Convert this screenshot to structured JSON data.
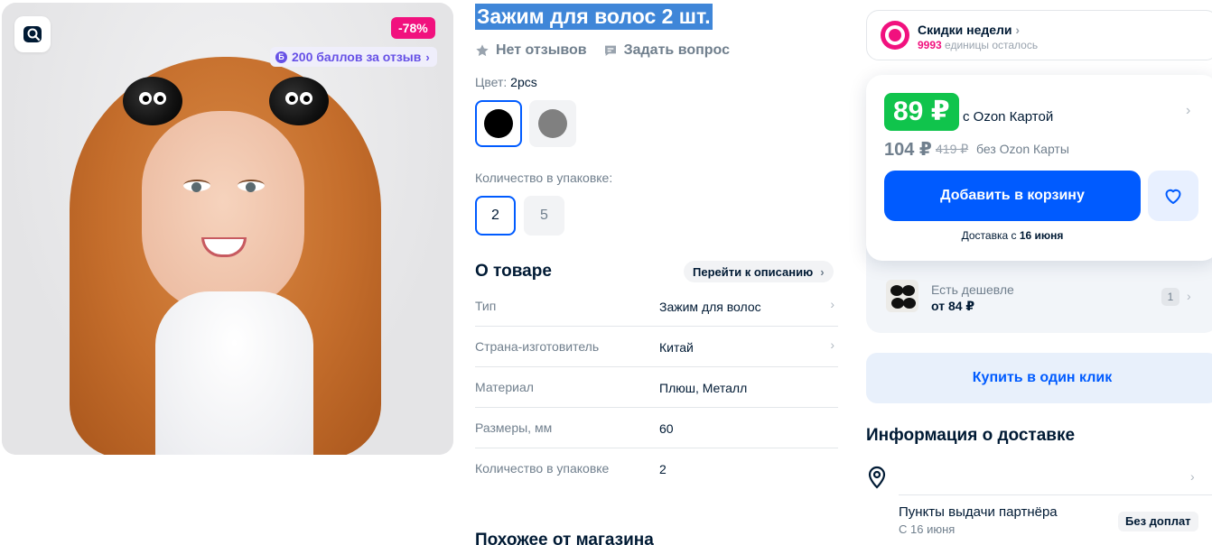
{
  "product": {
    "title": "Зажим для волос 2 шт.",
    "reviews_label": "Нет отзывов",
    "ask_label": "Задать вопрос"
  },
  "gallery": {
    "discount": "-78%",
    "points_label": "200 баллов за отзыв",
    "points_coin": "Б"
  },
  "variants": {
    "color_label": "Цвет:",
    "color_value": "2pcs",
    "swatches": [
      {
        "color": "#000000",
        "selected": true
      },
      {
        "color": "#808080",
        "selected": false
      }
    ],
    "qty_label": "Количество в упаковке:",
    "qty_options": [
      "2",
      "5"
    ],
    "qty_selected": "2"
  },
  "about": {
    "title": "О товаре",
    "link": "Перейти к описанию",
    "specs": [
      {
        "key": "Тип",
        "value": "Зажим для волос"
      },
      {
        "key": "Страна-изготовитель",
        "value": "Китай"
      },
      {
        "key": "Материал",
        "value": "Плюш, Металл"
      },
      {
        "key": "Размеры, мм",
        "value": "60"
      },
      {
        "key": "Количество в упаковке",
        "value": "2"
      }
    ]
  },
  "similar": {
    "title": "Похожее от магазина"
  },
  "weekly": {
    "title": "Скидки недели",
    "count": "9993",
    "remaining": "единицы осталось"
  },
  "pricing": {
    "card_price": "89 ₽",
    "card_note": "с Ozon Картой",
    "price": "104 ₽",
    "old_price": "419 ₽",
    "price_note": "без Ozon Карты",
    "cart_button": "Добавить в корзину",
    "delivery_prefix": "Доставка с",
    "delivery_date": "16 июня",
    "accent_color": "#005bff",
    "price_color": "#10c44c"
  },
  "cheaper": {
    "title": "Есть дешевле",
    "price": "от 84 ₽",
    "count": "1"
  },
  "oneclick": {
    "label": "Купить в один клик"
  },
  "delivery_info": {
    "title": "Информация о доставке",
    "pickup_title": "Пункты выдачи партнёра",
    "pickup_date": "С 16 июня",
    "free_badge": "Без доплат"
  }
}
